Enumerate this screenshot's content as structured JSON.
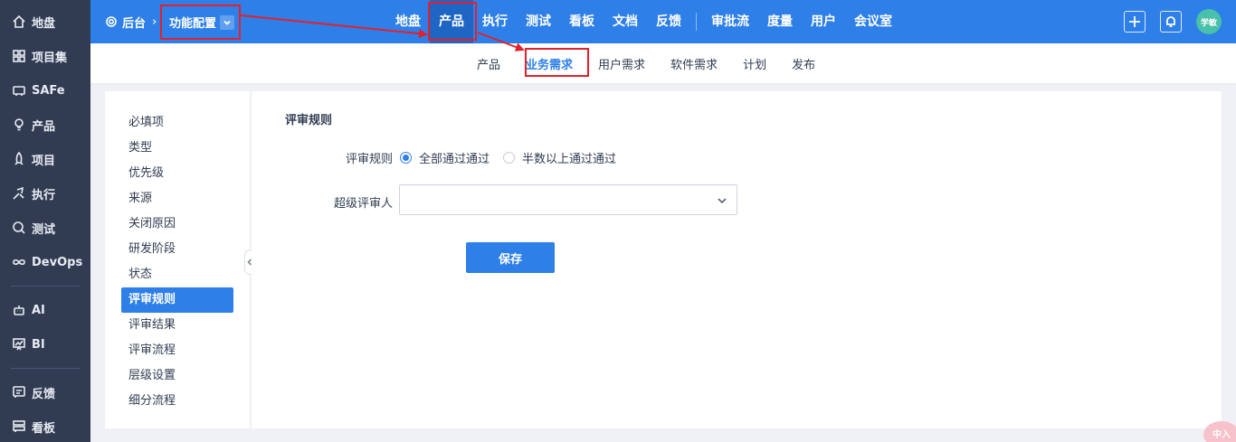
{
  "leftnav": {
    "items": [
      {
        "label": "地盘",
        "icon": "home-icon"
      },
      {
        "label": "项目集",
        "icon": "grid-icon"
      },
      {
        "label": "SAFe",
        "icon": "safe-icon"
      },
      {
        "label": "产品",
        "icon": "bulb-icon"
      },
      {
        "label": "项目",
        "icon": "rocket-icon"
      },
      {
        "label": "执行",
        "icon": "run-icon"
      },
      {
        "label": "测试",
        "icon": "search-test-icon"
      },
      {
        "label": "DevOps",
        "icon": "infinity-icon"
      },
      {
        "label": "AI",
        "icon": "robot-icon"
      },
      {
        "label": "BI",
        "icon": "chart-board-icon"
      },
      {
        "label": "反馈",
        "icon": "feedback-icon"
      },
      {
        "label": "看板",
        "icon": "kanban-icon"
      }
    ]
  },
  "topbar": {
    "back_label": "后台",
    "separator": "›",
    "func_config": "功能配置",
    "menu": [
      "地盘",
      "产品",
      "执行",
      "测试",
      "看板",
      "文档",
      "反馈",
      "审批流",
      "度量",
      "用户",
      "会议室"
    ],
    "active_menu": "产品",
    "avatar_text": "学敏"
  },
  "subnav": {
    "tabs": [
      "产品",
      "业务需求",
      "用户需求",
      "软件需求",
      "计划",
      "发布"
    ],
    "active": "业务需求"
  },
  "sidebar": {
    "items": [
      "必填项",
      "类型",
      "优先级",
      "来源",
      "关闭原因",
      "研发阶段",
      "状态",
      "评审规则",
      "评审结果",
      "评审流程",
      "层级设置",
      "细分流程"
    ],
    "active": "评审规则"
  },
  "form": {
    "title": "评审规则",
    "rule_label": "评审规则",
    "options": [
      "全部通过通过",
      "半数以上通过通过"
    ],
    "selected_option": "全部通过通过",
    "super_reviewer_label": "超级评审人",
    "super_reviewer_value": "",
    "save_label": "保存"
  },
  "ime_badge": "中入",
  "colors": {
    "primary": "#2e7fe8",
    "sidebar_bg": "#313c52",
    "highlight_box": "#e0222c"
  }
}
